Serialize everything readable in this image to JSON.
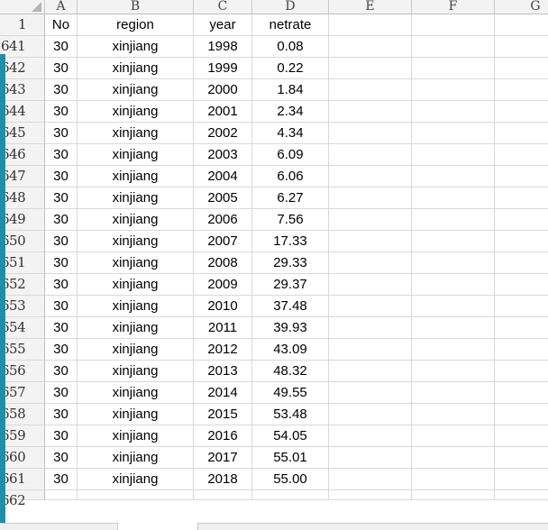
{
  "columns": [
    "A",
    "B",
    "C",
    "D",
    "E",
    "F",
    "G"
  ],
  "header_row": {
    "num": "1",
    "a": "No",
    "b": "region",
    "c": "year",
    "d": "netrate"
  },
  "rows": [
    {
      "num": "641",
      "a": "30",
      "b": "xinjiang",
      "c": "1998",
      "d": "0.08"
    },
    {
      "num": "642",
      "a": "30",
      "b": "xinjiang",
      "c": "1999",
      "d": "0.22"
    },
    {
      "num": "643",
      "a": "30",
      "b": "xinjiang",
      "c": "2000",
      "d": "1.84"
    },
    {
      "num": "644",
      "a": "30",
      "b": "xinjiang",
      "c": "2001",
      "d": "2.34"
    },
    {
      "num": "645",
      "a": "30",
      "b": "xinjiang",
      "c": "2002",
      "d": "4.34"
    },
    {
      "num": "646",
      "a": "30",
      "b": "xinjiang",
      "c": "2003",
      "d": "6.09"
    },
    {
      "num": "647",
      "a": "30",
      "b": "xinjiang",
      "c": "2004",
      "d": "6.06"
    },
    {
      "num": "648",
      "a": "30",
      "b": "xinjiang",
      "c": "2005",
      "d": "6.27"
    },
    {
      "num": "649",
      "a": "30",
      "b": "xinjiang",
      "c": "2006",
      "d": "7.56"
    },
    {
      "num": "650",
      "a": "30",
      "b": "xinjiang",
      "c": "2007",
      "d": "17.33"
    },
    {
      "num": "651",
      "a": "30",
      "b": "xinjiang",
      "c": "2008",
      "d": "29.33"
    },
    {
      "num": "652",
      "a": "30",
      "b": "xinjiang",
      "c": "2009",
      "d": "29.37"
    },
    {
      "num": "653",
      "a": "30",
      "b": "xinjiang",
      "c": "2010",
      "d": "37.48"
    },
    {
      "num": "654",
      "a": "30",
      "b": "xinjiang",
      "c": "2011",
      "d": "39.93"
    },
    {
      "num": "655",
      "a": "30",
      "b": "xinjiang",
      "c": "2012",
      "d": "43.09"
    },
    {
      "num": "656",
      "a": "30",
      "b": "xinjiang",
      "c": "2013",
      "d": "48.32"
    },
    {
      "num": "657",
      "a": "30",
      "b": "xinjiang",
      "c": "2014",
      "d": "49.55"
    },
    {
      "num": "658",
      "a": "30",
      "b": "xinjiang",
      "c": "2015",
      "d": "53.48"
    },
    {
      "num": "659",
      "a": "30",
      "b": "xinjiang",
      "c": "2016",
      "d": "54.05"
    },
    {
      "num": "660",
      "a": "30",
      "b": "xinjiang",
      "c": "2017",
      "d": "55.01"
    },
    {
      "num": "661",
      "a": "30",
      "b": "xinjiang",
      "c": "2018",
      "d": "55.00"
    }
  ],
  "partial_row": {
    "num": "662"
  },
  "colors": {
    "header_bg": "#f3f3f3",
    "grid": "#d9d9d9",
    "accent_stripe": "#1e8fa6"
  }
}
